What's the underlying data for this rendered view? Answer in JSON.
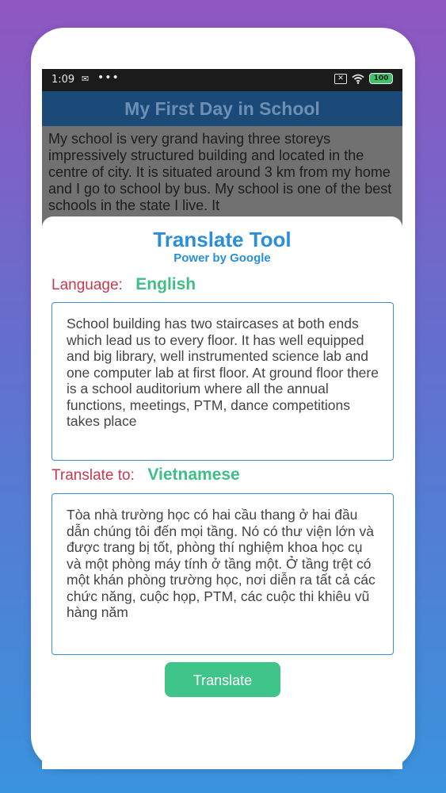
{
  "status_bar": {
    "time": "1:09",
    "icons": [
      "message-icon",
      "more-dots-icon",
      "no-sim-icon",
      "wifi-icon",
      "battery-icon"
    ],
    "dots": "•••",
    "battery": "100"
  },
  "article": {
    "title": "My First Day in School",
    "body": "My school is very grand having three storeys impressively structured building and located in the centre of city. It is situated around 3 km from my home and I go to school by bus. My school is one of the best schools in the state I live. It"
  },
  "translate_tool": {
    "title": "Translate Tool",
    "subtitle": "Power by Google",
    "source_label": "Language:",
    "source_language": "English",
    "source_text": "School building has two staircases at both ends which lead us to every floor. It has well equipped and big library, well instrumented science lab and one computer lab at first floor. At ground floor there is a school auditorium where all the annual functions, meetings, PTM, dance competitions takes place",
    "target_label": "Translate to:",
    "target_language": "Vietnamese",
    "target_text": "Tòa nhà trường học có hai cầu thang ở hai đầu dẫn chúng tôi đến mọi tầng. Nó có thư viện lớn và được trang bị tốt, phòng thí nghiệm khoa học cụ và một phòng máy tính ở tầng một. Ở tầng trệt có một khán phòng trường học, nơi diễn ra tất cả các chức năng, cuộc họp, PTM, các cuộc thi khiêu vũ hàng năm",
    "button_label": "Translate"
  },
  "colors": {
    "accent_blue": "#2a8fd9",
    "label_red": "#c8394f",
    "language_green": "#3fbf85",
    "button_green": "#3fc489",
    "header_blue": "#1c4a78"
  }
}
